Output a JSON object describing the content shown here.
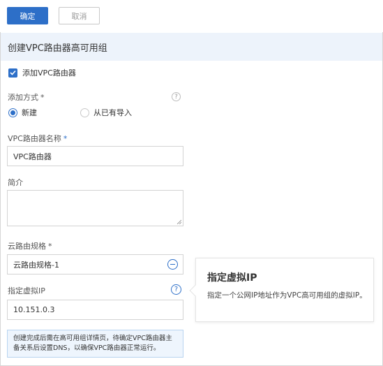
{
  "toolbar": {
    "confirm_label": "确定",
    "cancel_label": "取消"
  },
  "section": {
    "title": "创建VPC路由器高可用组"
  },
  "add_vpc_router": {
    "label": "添加VPC路由器",
    "checked": true
  },
  "add_method": {
    "label": "添加方式",
    "required_mark": "*",
    "help": "?",
    "options": [
      {
        "label": "新建",
        "selected": true
      },
      {
        "label": "从已有导入",
        "selected": false
      }
    ]
  },
  "router_name": {
    "label": "VPC路由器名称",
    "required_mark": "*",
    "value": "VPC路由器"
  },
  "description": {
    "label": "简介",
    "value": ""
  },
  "cloud_router_spec": {
    "label": "云路由规格",
    "required_mark": "*",
    "value": "云路由规格-1"
  },
  "virtual_ip": {
    "label": "指定虚拟IP",
    "help": "?",
    "value": "10.151.0.3"
  },
  "notice": {
    "text": "创建完成后需在高可用组详情页，待确定VPC路由器主备关系后设置DNS，以确保VPC路由器正常运行。"
  },
  "tooltip": {
    "title": "指定虚拟IP",
    "body": "指定一个公网IP地址作为VPC高可用组的虚拟IP。"
  },
  "colors": {
    "primary": "#2d6fc8",
    "header_bg": "#edf3fb",
    "notice_bg": "#eef5fd"
  }
}
